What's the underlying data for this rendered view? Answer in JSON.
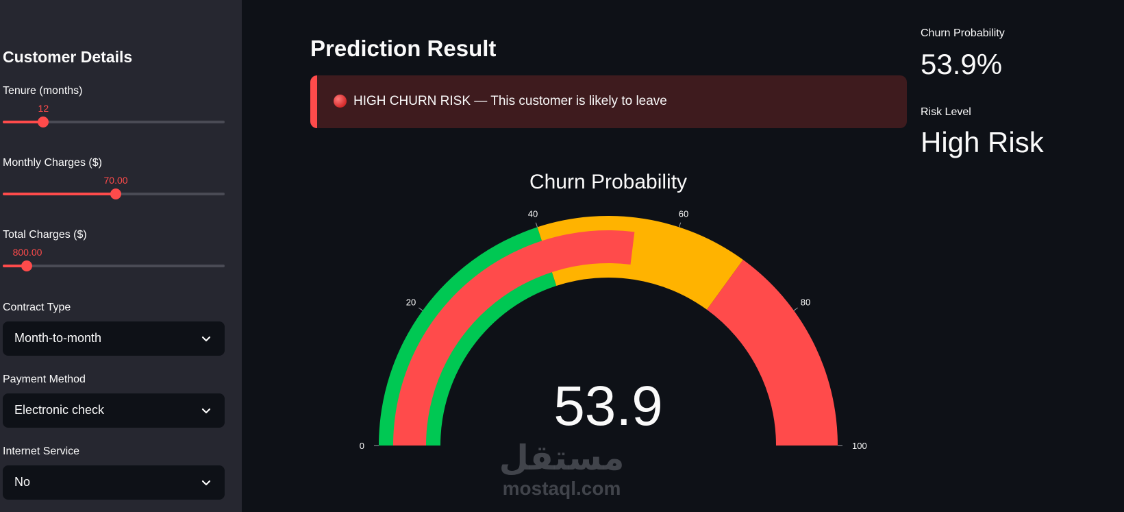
{
  "sidebar": {
    "title": "Customer Details",
    "sliders": [
      {
        "label": "Tenure (months)",
        "display": "12",
        "value": 12,
        "min": 0,
        "max": 72
      },
      {
        "label": "Monthly Charges ($)",
        "display": "70.00",
        "value": 70,
        "min": 18,
        "max": 120
      },
      {
        "label": "Total Charges ($)",
        "display": "800.00",
        "value": 800,
        "min": 0,
        "max": 9000
      }
    ],
    "selects": [
      {
        "label": "Contract Type",
        "value": "Month-to-month"
      },
      {
        "label": "Payment Method",
        "value": "Electronic check"
      },
      {
        "label": "Internet Service",
        "value": "No"
      }
    ]
  },
  "main": {
    "title": "Prediction Result",
    "alert": "HIGH CHURN RISK — This customer is likely to leave",
    "metrics": [
      {
        "label": "Churn Probability",
        "value": "53.9%"
      },
      {
        "label": "Risk Level",
        "value": "High Risk"
      }
    ]
  },
  "watermark": {
    "arabic": "مستقل",
    "latin": "mostaql.com"
  },
  "colors": {
    "accent": "#ff4b4b",
    "green": "#00c853",
    "amber": "#ffb300",
    "red": "#ff4b4b"
  },
  "chart_data": {
    "type": "gauge",
    "title": "Churn Probability",
    "value": 53.9,
    "value_text": "53.9",
    "range": [
      0,
      100
    ],
    "ticks": [
      0,
      20,
      40,
      60,
      80,
      100
    ],
    "tick_labels": [
      "0",
      "20",
      "40",
      "60",
      "80",
      "100"
    ],
    "steps": [
      {
        "range": [
          0,
          40
        ],
        "color": "#00c853"
      },
      {
        "range": [
          40,
          70
        ],
        "color": "#ffb300"
      },
      {
        "range": [
          70,
          100
        ],
        "color": "#ff4b4b"
      }
    ],
    "bar_color": "#ff4b4b"
  }
}
